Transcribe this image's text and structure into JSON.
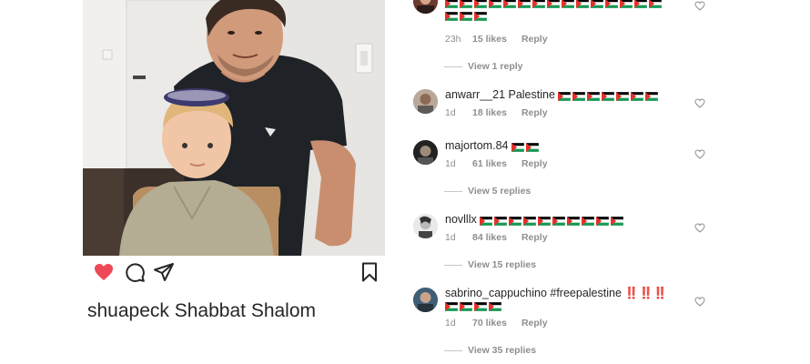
{
  "post": {
    "caption_user": "shuapeck",
    "caption_text": " Shabbat Shalom",
    "like_icon": "heart-filled-icon",
    "comment_icon": "comment-bubble-icon",
    "share_icon": "paper-plane-icon",
    "save_icon": "bookmark-icon",
    "like_color": "#ed4956"
  },
  "comments": [
    {
      "username": "",
      "text_prefix": "",
      "flag_count_line1": 15,
      "flag_count_line2": 3,
      "time": "23h",
      "likes": "15 likes",
      "reply": "Reply",
      "view_replies": "View 1 reply"
    },
    {
      "username": "anwarr__21",
      "text_prefix": " Palestine ",
      "flag_count": 7,
      "time": "1d",
      "likes": "18 likes",
      "reply": "Reply"
    },
    {
      "username": "majortom.84",
      "flag_count": 2,
      "time": "1d",
      "likes": "61 likes",
      "reply": "Reply",
      "view_replies": "View 5 replies"
    },
    {
      "username": "novlllx",
      "flag_count": 10,
      "time": "1d",
      "likes": "84 likes",
      "reply": "Reply",
      "view_replies": "View 15 replies"
    },
    {
      "username": "sabrino_cappuchino",
      "hashtag": "#freepalestine",
      "bangs": "‼️‼️‼️",
      "flag_count": 4,
      "time": "1d",
      "likes": "70 likes",
      "reply": "Reply",
      "view_replies": "View 35 replies"
    }
  ],
  "colors": {
    "meta_gray": "#8e8e8e",
    "hashtag_blue": "#00376b",
    "flag_black": "#000000",
    "flag_white": "#ffffff",
    "flag_green": "#149954",
    "flag_red": "#e4312b"
  }
}
